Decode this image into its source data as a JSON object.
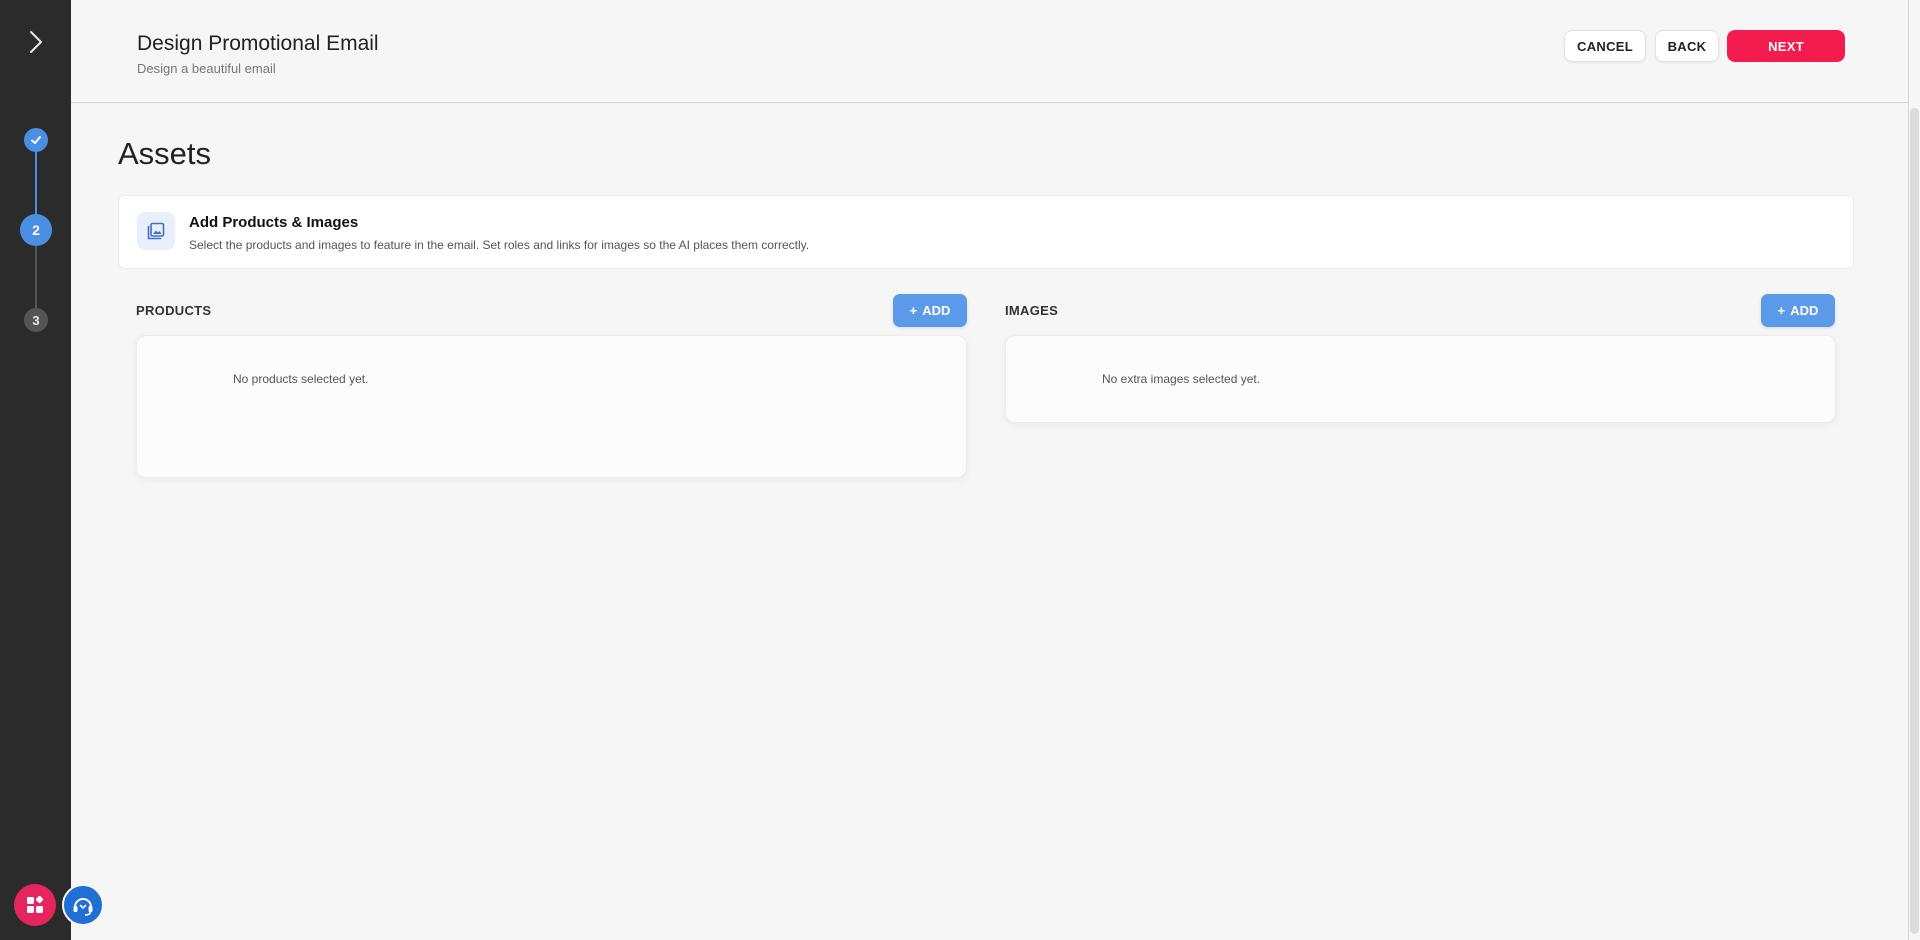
{
  "header": {
    "title": "Design Promotional Email",
    "subtitle": "Design a beautiful email",
    "cancel_label": "CANCEL",
    "back_label": "BACK",
    "next_label": "NEXT"
  },
  "sidebar": {
    "toggle_icon": "chevron-right-icon",
    "steps": [
      {
        "label": "",
        "state": "completed",
        "icon": "check-icon"
      },
      {
        "label": "2",
        "state": "active"
      },
      {
        "label": "3",
        "state": "upcoming"
      }
    ],
    "fab_apps_icon": "apps-grid-icon",
    "fab_support_icon": "headset-support-icon"
  },
  "page": {
    "title": "Assets"
  },
  "info_card": {
    "icon": "image-gallery-icon",
    "title": "Add Products & Images",
    "description": "Select the products and images to feature in the email. Set roles and links for images so the AI places them correctly."
  },
  "products": {
    "label": "PRODUCTS",
    "add_label": "ADD",
    "empty_text": "No products selected yet."
  },
  "images": {
    "label": "IMAGES",
    "add_label": "ADD",
    "empty_text": "No extra images selected yet."
  },
  "colors": {
    "accent_blue": "#4a8fe4",
    "add_button_blue": "#5b9ae8",
    "next_red": "#f41c4e",
    "sidebar_dark": "#2b2b2b",
    "fab_pink": "#e6245d",
    "fab_blue": "#1f6fd6"
  }
}
